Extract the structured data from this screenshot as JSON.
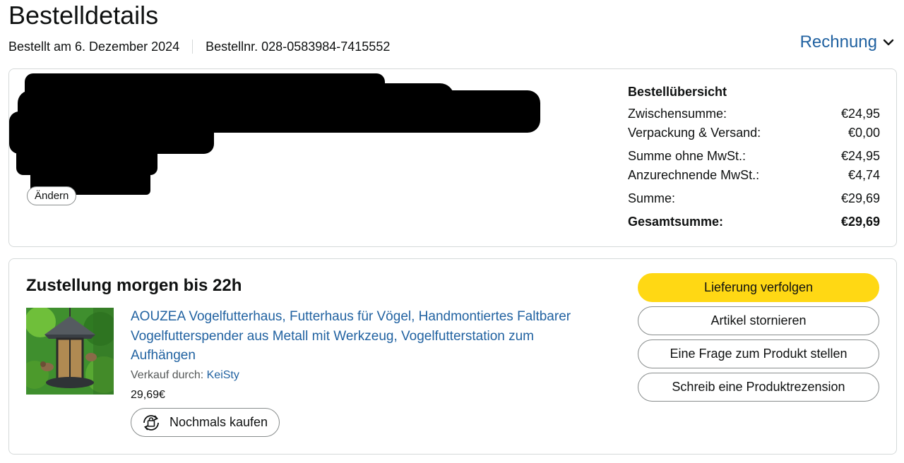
{
  "header": {
    "title": "Bestelldetails",
    "order_date": "Bestellt am 6. Dezember 2024",
    "order_number": "Bestellnr. 028-0583984-7415552",
    "invoice_label": "Rechnung"
  },
  "address": {
    "change_label": "Ändern"
  },
  "summary": {
    "title": "Bestellübersicht",
    "rows": [
      {
        "label": "Zwischensumme:",
        "value": "€24,95"
      },
      {
        "label": "Verpackung & Versand:",
        "value": "€0,00"
      },
      {
        "label": "Summe ohne MwSt.:",
        "value": "€24,95"
      },
      {
        "label": "Anzurechnende MwSt.:",
        "value": "€4,74"
      },
      {
        "label": "Summe:",
        "value": "€29,69"
      },
      {
        "label": "Gesamtsumme:",
        "value": "€29,69"
      }
    ]
  },
  "shipment": {
    "status": "Zustellung morgen bis 22h",
    "product_title": "AOUZEA Vogelfutterhaus, Futterhaus für Vögel, Handmontiertes Faltbarer Vogelfutterspender aus Metall mit Werkzeug, Vogelfutterstation zum Aufhängen",
    "seller_prefix": "Verkauf durch:",
    "seller_name": "KeiSty",
    "price": "29,69€",
    "rebuy_label": "Nochmals kaufen"
  },
  "actions": {
    "track": "Lieferung verfolgen",
    "cancel": "Artikel stornieren",
    "question": "Eine Frage zum Produkt stellen",
    "review": "Schreib eine Produktrezension"
  },
  "colors": {
    "link": "#2162a1",
    "primary_button": "#ffd814",
    "border": "#d5d9d9"
  }
}
